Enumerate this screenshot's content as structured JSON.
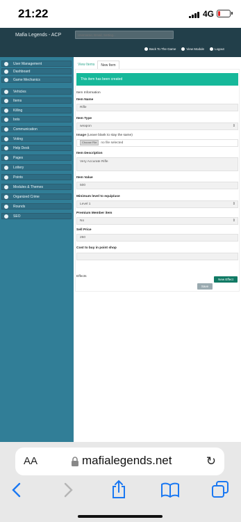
{
  "status": {
    "time": "21:22",
    "network": "4G"
  },
  "header": {
    "brand": "Mafia Legends - ACP",
    "search_placeholder": "Username, Email, Setting...",
    "nav": [
      "Back To The Game",
      "View Module",
      "Logout"
    ]
  },
  "sidebar": {
    "items": [
      "User Management",
      "Dashboard",
      "Game Mechanics",
      "Vehicles",
      "Items",
      "Killing",
      "bots",
      "Communication",
      "Voting",
      "Help Desk",
      "Pages",
      "Lottery",
      "Points",
      "Modules & Themes",
      "Organized Crime",
      "Rounds",
      "SEO"
    ]
  },
  "tabs": {
    "view_items": "View Items",
    "new_item": "New Item"
  },
  "alert": "This item has been created",
  "form": {
    "section_title": "Item Information",
    "item_name_label": "Item Name",
    "item_name_value": "Rifle",
    "item_type_label": "Item Type",
    "item_type_value": "weapon",
    "image_label": "Image",
    "image_hint": "(Leave blank to stay the same)",
    "choose_file": "Choose File",
    "no_file": "no file selected",
    "description_label": "Item Description",
    "description_value": "Very Accurate Rifle",
    "value_label": "Item Value",
    "value_value": "500",
    "min_level_label": "Minimum level to equip/use",
    "min_level_value": "Level 1",
    "premium_label": "Premium Member item",
    "premium_value": "No",
    "sell_price_label": "Sell Price",
    "sell_price_value": "250",
    "cost_points_label": "Cost to buy in point shop",
    "cost_points_value": "",
    "effects_label": "Effects",
    "new_effect_button": "New Effect",
    "save_button": "Save"
  },
  "browser": {
    "aa": "AA",
    "url": "mafialegends.net"
  },
  "colors": {
    "sidebar": "#317e97",
    "topbar": "#223f4a",
    "alert": "#16b89a",
    "accent": "#1a78f2"
  },
  "icons": {
    "status": [
      "signal-icon",
      "battery-icon"
    ],
    "browser": [
      "lock-icon",
      "reload-icon",
      "back-icon",
      "forward-icon",
      "share-icon",
      "bookmarks-icon",
      "tabs-icon"
    ]
  }
}
